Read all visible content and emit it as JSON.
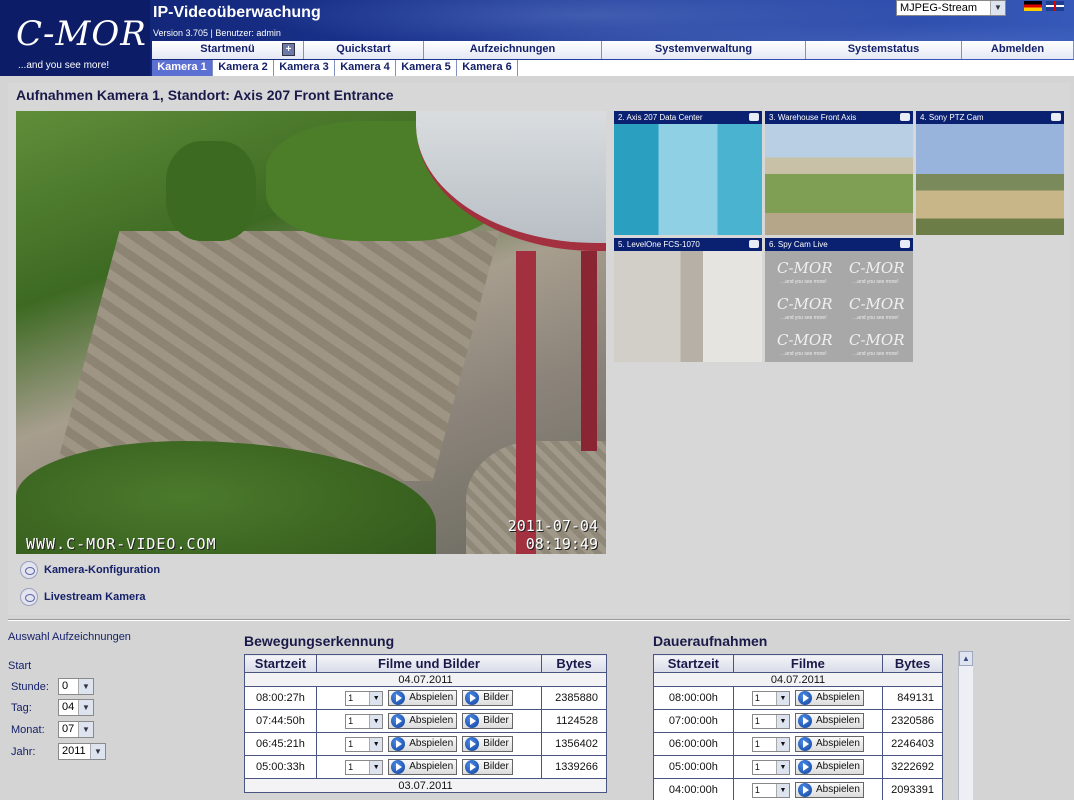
{
  "header": {
    "logo_text": "C-MOR",
    "logo_tagline": "...and you see more!",
    "app_title": "IP-Videoüberwachung",
    "version_line": "Version 3.705 | Benutzer: admin",
    "stream_select": "MJPEG-Stream"
  },
  "menu": {
    "items": [
      {
        "label": "Startmenü"
      },
      {
        "label": "Quickstart"
      },
      {
        "label": "Aufzeichnungen"
      },
      {
        "label": "Systemverwaltung"
      },
      {
        "label": "Systemstatus"
      },
      {
        "label": "Abmelden"
      }
    ],
    "plus_symbol": "+"
  },
  "camera_tabs": [
    "Kamera 1",
    "Kamera 2",
    "Kamera 3",
    "Kamera 4",
    "Kamera 5",
    "Kamera 6"
  ],
  "main": {
    "title": "Aufnahmen Kamera 1, Standort: Axis 207 Front Entrance",
    "live_overlay_url": "WWW.C-MOR-VIDEO.COM",
    "live_overlay_date": "2011-07-04",
    "live_overlay_time": "08:19:49",
    "thumbnails": [
      "2. Axis 207 Data Center",
      "3. Warehouse Front Axis",
      "4. Sony PTZ Cam",
      "5. LevelOne FCS-1070",
      "6. Spy Cam Live"
    ],
    "placeholder_logo": "C-MOR",
    "placeholder_tag": "...and you see more!",
    "actions": [
      {
        "label": "Kamera-Konfiguration"
      },
      {
        "label": "Livestream Kamera"
      }
    ]
  },
  "recordings": {
    "heading": "Auswahl Aufzeichnungen",
    "start_label": "Start",
    "selectors": [
      {
        "label": "Stunde:",
        "value": "0"
      },
      {
        "label": "Tag:",
        "value": "04"
      },
      {
        "label": "Monat:",
        "value": "07"
      },
      {
        "label": "Jahr:",
        "value": "2011"
      }
    ],
    "motion": {
      "title": "Bewegungserkennung",
      "headers": [
        "Startzeit",
        "Filme und Bilder",
        "Bytes"
      ],
      "date_1": "04.07.2011",
      "date_2": "03.07.2011",
      "rows": [
        {
          "time": "08:00:27h",
          "sel": "1",
          "play": "Abspielen",
          "images": "Bilder",
          "bytes": "2385880"
        },
        {
          "time": "07:44:50h",
          "sel": "1",
          "play": "Abspielen",
          "images": "Bilder",
          "bytes": "1124528"
        },
        {
          "time": "06:45:21h",
          "sel": "1",
          "play": "Abspielen",
          "images": "Bilder",
          "bytes": "1356402"
        },
        {
          "time": "05:00:33h",
          "sel": "1",
          "play": "Abspielen",
          "images": "Bilder",
          "bytes": "1339266"
        }
      ]
    },
    "continuous": {
      "title": "Daueraufnahmen",
      "headers": [
        "Startzeit",
        "Filme",
        "Bytes"
      ],
      "date_1": "04.07.2011",
      "rows": [
        {
          "time": "08:00:00h",
          "sel": "1",
          "play": "Abspielen",
          "bytes": "849131"
        },
        {
          "time": "07:00:00h",
          "sel": "1",
          "play": "Abspielen",
          "bytes": "2320586"
        },
        {
          "time": "06:00:00h",
          "sel": "1",
          "play": "Abspielen",
          "bytes": "2246403"
        },
        {
          "time": "05:00:00h",
          "sel": "1",
          "play": "Abspielen",
          "bytes": "3222692"
        },
        {
          "time": "04:00:00h",
          "sel": "1",
          "play": "Abspielen",
          "bytes": "2093391"
        }
      ]
    }
  }
}
